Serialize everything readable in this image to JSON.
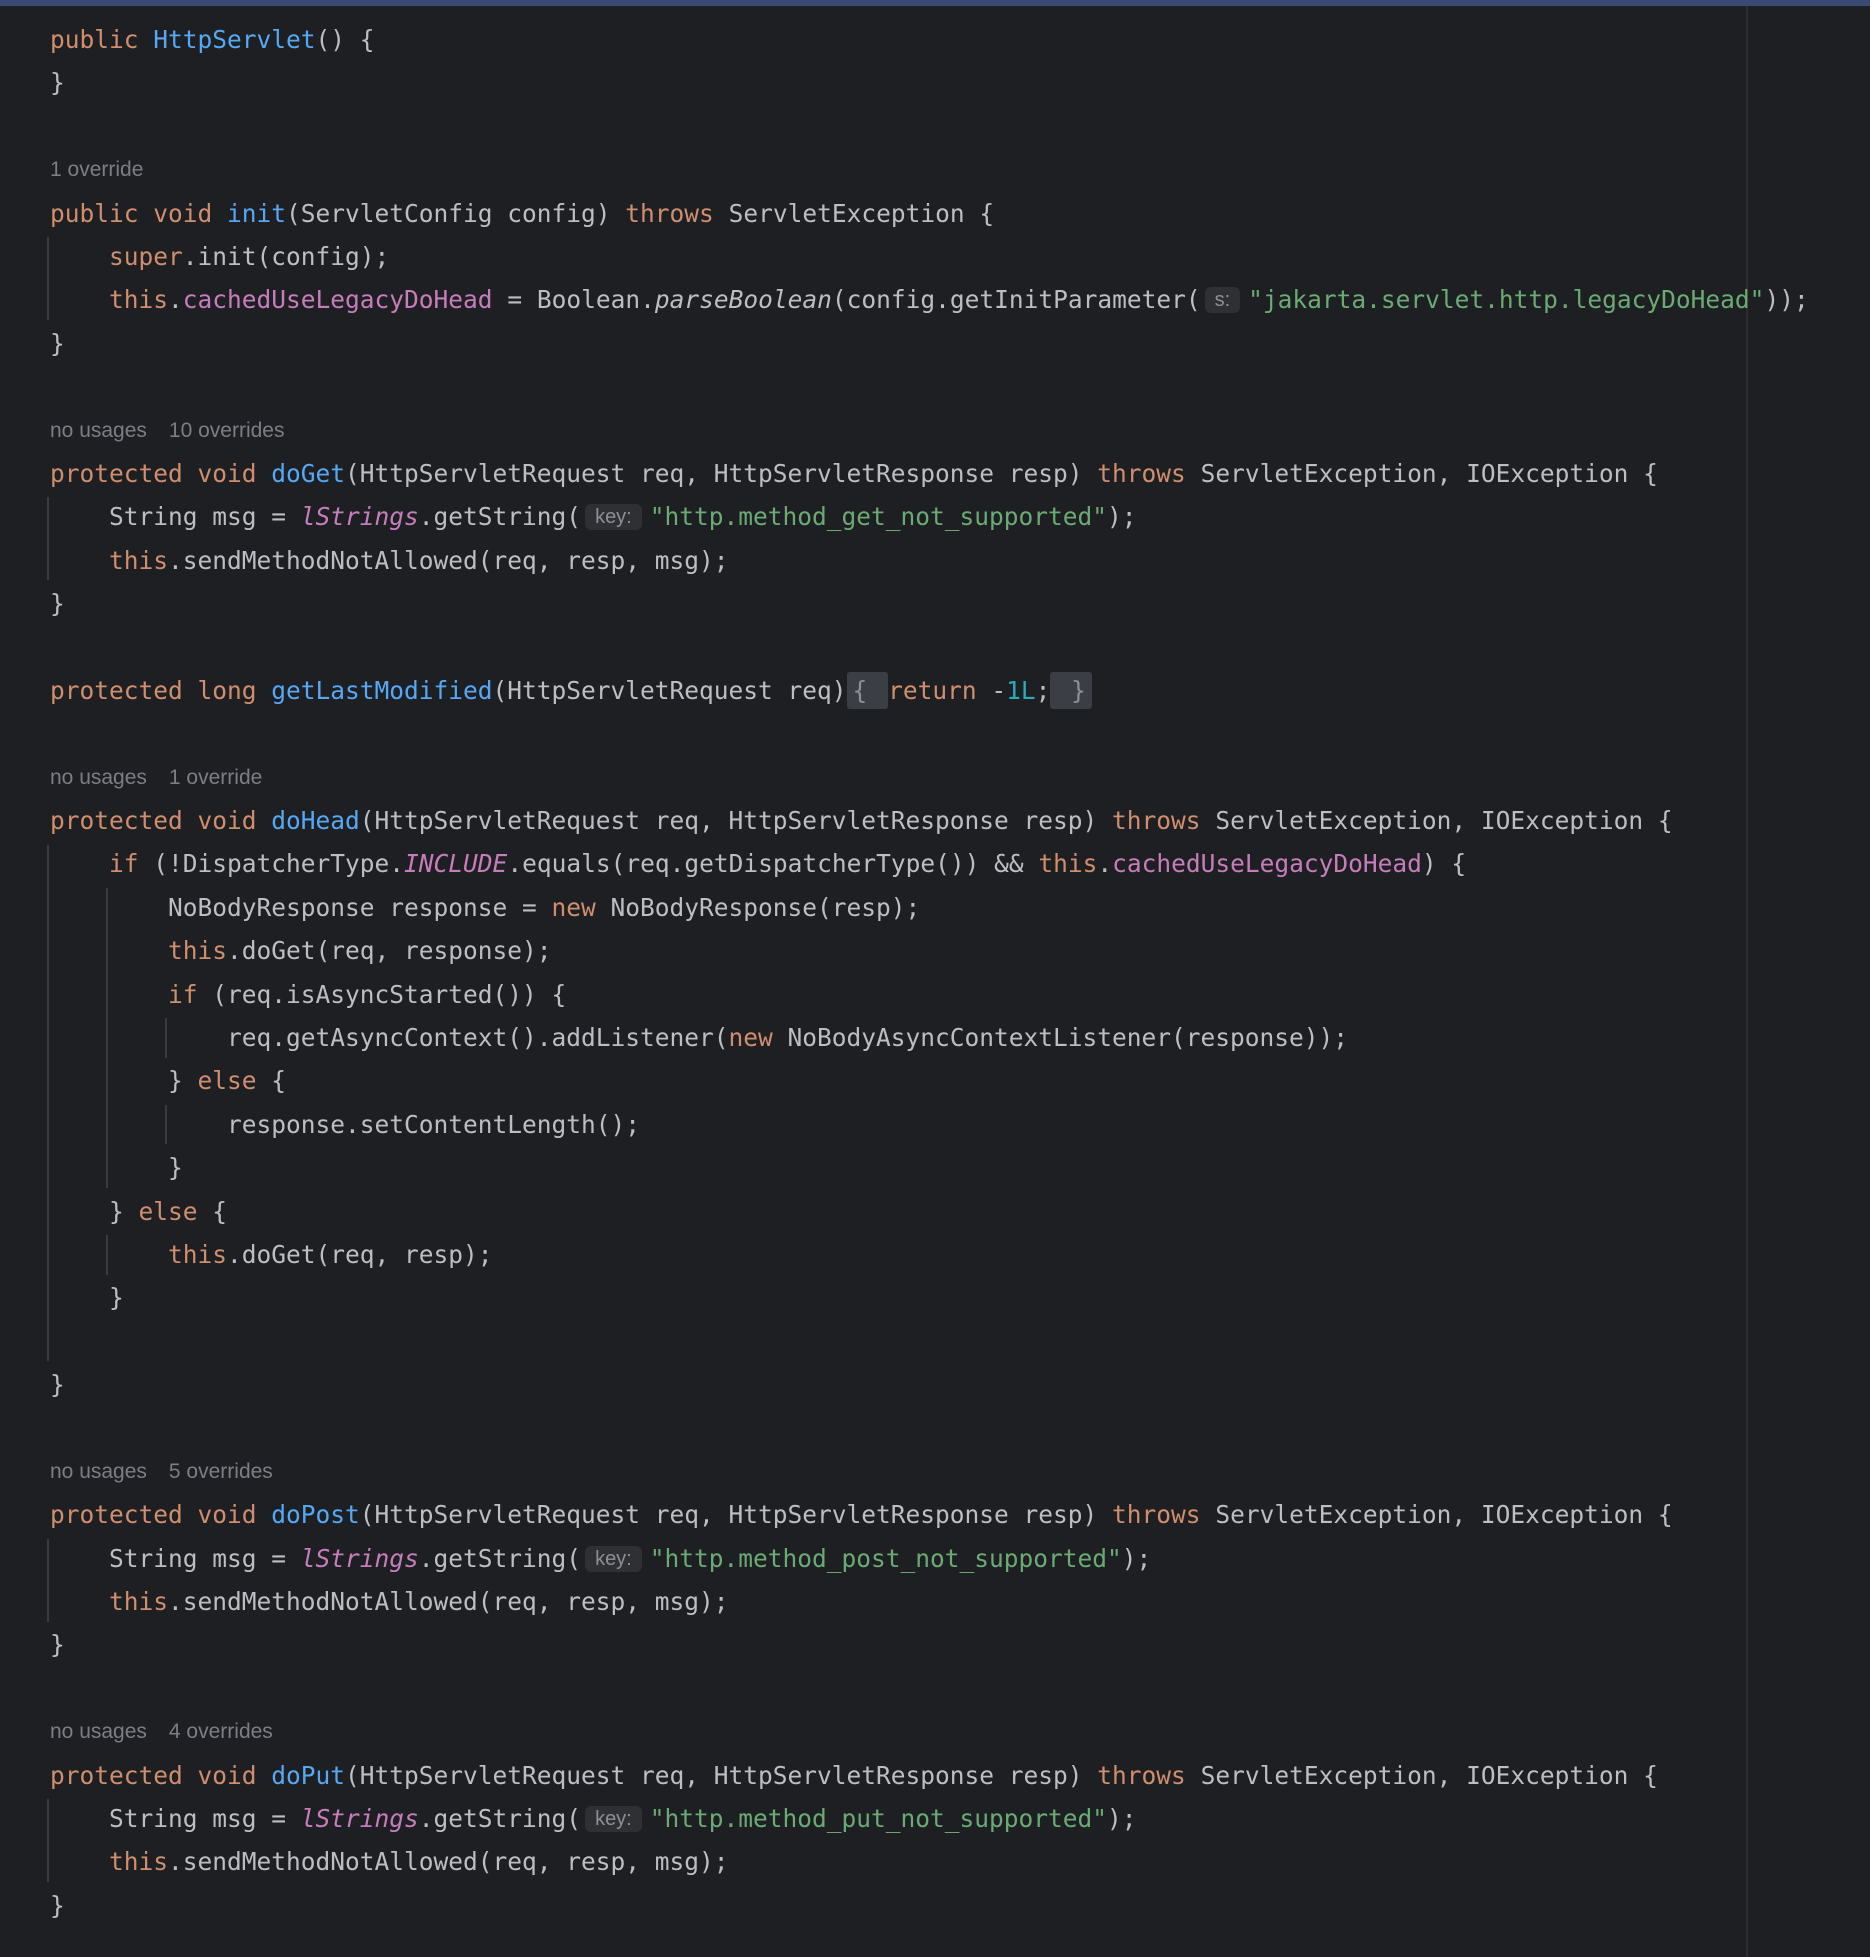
{
  "editor": {
    "code_lines": [
      {
        "kind": "code",
        "indent": 0,
        "tokens": [
          [
            "kw",
            "public "
          ],
          [
            "fn",
            "HttpServlet"
          ],
          [
            "",
            "() {"
          ]
        ]
      },
      {
        "kind": "code",
        "indent": 0,
        "tokens": [
          [
            "",
            "}"
          ]
        ]
      },
      {
        "kind": "blank"
      },
      {
        "kind": "hint",
        "texts": [
          "1 override"
        ]
      },
      {
        "kind": "code",
        "indent": 0,
        "tokens": [
          [
            "kw",
            "public void "
          ],
          [
            "fn",
            "init"
          ],
          [
            "",
            "(ServletConfig config) "
          ],
          [
            "kw",
            "throws "
          ],
          [
            "",
            "ServletException {"
          ]
        ]
      },
      {
        "kind": "code",
        "indent": 1,
        "tokens": [
          [
            "kw",
            "super"
          ],
          [
            "",
            ".init(config);"
          ]
        ]
      },
      {
        "kind": "code",
        "indent": 1,
        "tokens": [
          [
            "kw",
            "this"
          ],
          [
            "",
            "."
          ],
          [
            "field",
            "cachedUseLegacyDoHead"
          ],
          [
            "",
            " = Boolean."
          ],
          [
            "smethod",
            "parseBoolean"
          ],
          [
            "",
            "(config.getInitParameter("
          ],
          [
            "inlay",
            "s:"
          ],
          [
            "str",
            "\"jakarta.servlet.http.legacyDoHead\""
          ],
          [
            "",
            "));"
          ]
        ]
      },
      {
        "kind": "code",
        "indent": 0,
        "tokens": [
          [
            "",
            "}"
          ]
        ]
      },
      {
        "kind": "blank"
      },
      {
        "kind": "hint",
        "texts": [
          "no usages",
          "10 overrides"
        ]
      },
      {
        "kind": "code",
        "indent": 0,
        "tokens": [
          [
            "kw",
            "protected void "
          ],
          [
            "fn",
            "doGet"
          ],
          [
            "",
            "(HttpServletRequest req, HttpServletResponse resp) "
          ],
          [
            "kw",
            "throws "
          ],
          [
            "",
            "ServletException, IOException {"
          ]
        ]
      },
      {
        "kind": "code",
        "indent": 1,
        "tokens": [
          [
            "",
            "String msg = "
          ],
          [
            "sfield",
            "lStrings"
          ],
          [
            "",
            ".getString("
          ],
          [
            "inlay",
            "key:"
          ],
          [
            "str",
            "\"http.method_get_not_supported\""
          ],
          [
            "",
            ");"
          ]
        ]
      },
      {
        "kind": "code",
        "indent": 1,
        "tokens": [
          [
            "kw",
            "this"
          ],
          [
            "",
            ".sendMethodNotAllowed(req, resp, msg);"
          ]
        ]
      },
      {
        "kind": "code",
        "indent": 0,
        "tokens": [
          [
            "",
            "}"
          ]
        ]
      },
      {
        "kind": "blank"
      },
      {
        "kind": "code",
        "indent": 0,
        "tokens": [
          [
            "kw",
            "protected long "
          ],
          [
            "fn",
            "getLastModified"
          ],
          [
            "",
            "(HttpServletRequest req)"
          ],
          [
            "fold",
            "{ "
          ],
          [
            "kw",
            "return "
          ],
          [
            "",
            "-"
          ],
          [
            "num",
            "1L"
          ],
          [
            "",
            ";"
          ],
          [
            "fold",
            " }"
          ]
        ]
      },
      {
        "kind": "blank"
      },
      {
        "kind": "hint",
        "texts": [
          "no usages",
          "1 override"
        ]
      },
      {
        "kind": "code",
        "indent": 0,
        "tokens": [
          [
            "kw",
            "protected void "
          ],
          [
            "fn",
            "doHead"
          ],
          [
            "",
            "(HttpServletRequest req, HttpServletResponse resp) "
          ],
          [
            "kw",
            "throws "
          ],
          [
            "",
            "ServletException, IOException {"
          ]
        ]
      },
      {
        "kind": "code",
        "indent": 1,
        "tokens": [
          [
            "kw",
            "if "
          ],
          [
            "",
            "(!DispatcherType."
          ],
          [
            "sfield",
            "INCLUDE"
          ],
          [
            "",
            ".equals(req.getDispatcherType()) && "
          ],
          [
            "kw",
            "this"
          ],
          [
            "",
            "."
          ],
          [
            "field",
            "cachedUseLegacyDoHead"
          ],
          [
            "",
            ") {"
          ]
        ]
      },
      {
        "kind": "code",
        "indent": 2,
        "tokens": [
          [
            "",
            "NoBodyResponse response = "
          ],
          [
            "kw",
            "new "
          ],
          [
            "",
            "NoBodyResponse(resp);"
          ]
        ]
      },
      {
        "kind": "code",
        "indent": 2,
        "tokens": [
          [
            "kw",
            "this"
          ],
          [
            "",
            ".doGet(req, response);"
          ]
        ]
      },
      {
        "kind": "code",
        "indent": 2,
        "tokens": [
          [
            "kw",
            "if "
          ],
          [
            "",
            "(req.isAsyncStarted()) {"
          ]
        ]
      },
      {
        "kind": "code",
        "indent": 3,
        "tokens": [
          [
            "",
            "req.getAsyncContext().addListener("
          ],
          [
            "kw",
            "new "
          ],
          [
            "",
            "NoBodyAsyncContextListener(response));"
          ]
        ]
      },
      {
        "kind": "code",
        "indent": 2,
        "tokens": [
          [
            "",
            "} "
          ],
          [
            "kw",
            "else "
          ],
          [
            "",
            "{"
          ]
        ]
      },
      {
        "kind": "code",
        "indent": 3,
        "tokens": [
          [
            "",
            "response.setContentLength();"
          ]
        ]
      },
      {
        "kind": "code",
        "indent": 2,
        "tokens": [
          [
            "",
            "}"
          ]
        ]
      },
      {
        "kind": "code",
        "indent": 1,
        "tokens": [
          [
            "",
            "} "
          ],
          [
            "kw",
            "else "
          ],
          [
            "",
            "{"
          ]
        ]
      },
      {
        "kind": "code",
        "indent": 2,
        "tokens": [
          [
            "kw",
            "this"
          ],
          [
            "",
            ".doGet(req, resp);"
          ]
        ]
      },
      {
        "kind": "code",
        "indent": 1,
        "tokens": [
          [
            "",
            "}"
          ]
        ]
      },
      {
        "kind": "blank"
      },
      {
        "kind": "code",
        "indent": 0,
        "tokens": [
          [
            "",
            "}"
          ]
        ]
      },
      {
        "kind": "blank"
      },
      {
        "kind": "hint",
        "texts": [
          "no usages",
          "5 overrides"
        ]
      },
      {
        "kind": "code",
        "indent": 0,
        "tokens": [
          [
            "kw",
            "protected void "
          ],
          [
            "fn",
            "doPost"
          ],
          [
            "",
            "(HttpServletRequest req, HttpServletResponse resp) "
          ],
          [
            "kw",
            "throws "
          ],
          [
            "",
            "ServletException, IOException {"
          ]
        ]
      },
      {
        "kind": "code",
        "indent": 1,
        "tokens": [
          [
            "",
            "String msg = "
          ],
          [
            "sfield",
            "lStrings"
          ],
          [
            "",
            ".getString("
          ],
          [
            "inlay",
            "key:"
          ],
          [
            "str",
            "\"http.method_post_not_supported\""
          ],
          [
            "",
            ");"
          ]
        ]
      },
      {
        "kind": "code",
        "indent": 1,
        "tokens": [
          [
            "kw",
            "this"
          ],
          [
            "",
            ".sendMethodNotAllowed(req, resp, msg);"
          ]
        ]
      },
      {
        "kind": "code",
        "indent": 0,
        "tokens": [
          [
            "",
            "}"
          ]
        ]
      },
      {
        "kind": "blank"
      },
      {
        "kind": "hint",
        "texts": [
          "no usages",
          "4 overrides"
        ]
      },
      {
        "kind": "code",
        "indent": 0,
        "tokens": [
          [
            "kw",
            "protected void "
          ],
          [
            "fn",
            "doPut"
          ],
          [
            "",
            "(HttpServletRequest req, HttpServletResponse resp) "
          ],
          [
            "kw",
            "throws "
          ],
          [
            "",
            "ServletException, IOException {"
          ]
        ]
      },
      {
        "kind": "code",
        "indent": 1,
        "tokens": [
          [
            "",
            "String msg = "
          ],
          [
            "sfield",
            "lStrings"
          ],
          [
            "",
            ".getString("
          ],
          [
            "inlay",
            "key:"
          ],
          [
            "str",
            "\"http.method_put_not_supported\""
          ],
          [
            "",
            ");"
          ]
        ]
      },
      {
        "kind": "code",
        "indent": 1,
        "tokens": [
          [
            "kw",
            "this"
          ],
          [
            "",
            ".sendMethodNotAllowed(req, resp, msg);"
          ]
        ]
      },
      {
        "kind": "code",
        "indent": 0,
        "tokens": [
          [
            "",
            "}"
          ]
        ]
      }
    ],
    "colors": {
      "background": "#1e1f22",
      "keyword": "#cf8e6d",
      "function_declaration": "#56a8f5",
      "string": "#6aab73",
      "field": "#c77dbb",
      "number": "#2aacb8",
      "default_text": "#bcbec4",
      "hint_text": "#7b7e85"
    }
  }
}
